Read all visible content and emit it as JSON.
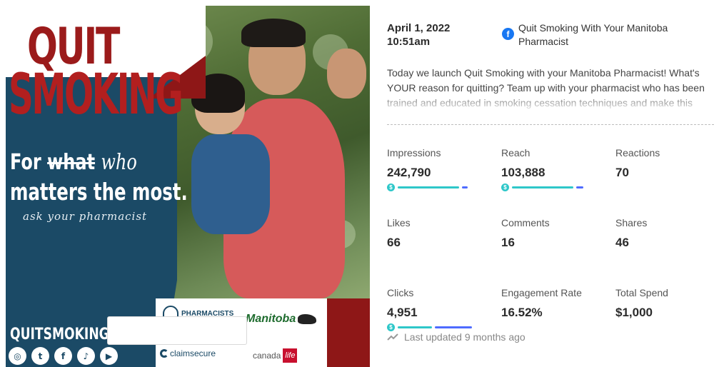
{
  "creative": {
    "headline_line1": "QUIT",
    "headline_line2": "SMOKING",
    "tag_for": "For",
    "tag_what": "what",
    "tag_who": "who",
    "tag_line2": "matters the most.",
    "ask": "ask your pharmacist",
    "hashtag": "QUITSMOKINGMB",
    "social_icons": [
      "instagram-icon",
      "twitter-icon",
      "facebook-icon",
      "tiktok-icon",
      "youtube-icon"
    ],
    "logos": {
      "pharmacists": "PHARMACISTS",
      "manitoba": "Manitoba",
      "claimsecure": "claimsecure",
      "canada": "canada",
      "life": "life"
    },
    "colors": {
      "blue_panel": "#1b4a66",
      "red": "#9b1b1b"
    }
  },
  "post": {
    "date": "April 1, 2022",
    "time": "10:51am",
    "page_name": "Quit Smoking With Your Manitoba Pharmacist",
    "platform_icon": "facebook-icon",
    "text": "Today we launch Quit Smoking with your Manitoba Pharmacist! What's YOUR reason for quitting? Team up with your pharmacist who has been trained and educated in smoking cessation techniques and make this"
  },
  "metrics": {
    "impressions": {
      "label": "Impressions",
      "value": "242,790",
      "paid_fraction": 0.88
    },
    "reach": {
      "label": "Reach",
      "value": "103,888",
      "paid_fraction": 0.88
    },
    "reactions": {
      "label": "Reactions",
      "value": "70"
    },
    "likes": {
      "label": "Likes",
      "value": "66"
    },
    "comments": {
      "label": "Comments",
      "value": "16"
    },
    "shares": {
      "label": "Shares",
      "value": "46"
    },
    "clicks": {
      "label": "Clicks",
      "value": "4,951",
      "paid_fraction": 0.45
    },
    "engagement_rate": {
      "label": "Engagement Rate",
      "value": "16.52%"
    },
    "total_spend": {
      "label": "Total Spend",
      "value": "$1,000"
    }
  },
  "footer": {
    "last_updated": "Last updated 9 months ago"
  },
  "colors": {
    "paid_bar": "#2ec7c9",
    "organic_bar": "#4e6bff",
    "facebook": "#1877f2"
  }
}
